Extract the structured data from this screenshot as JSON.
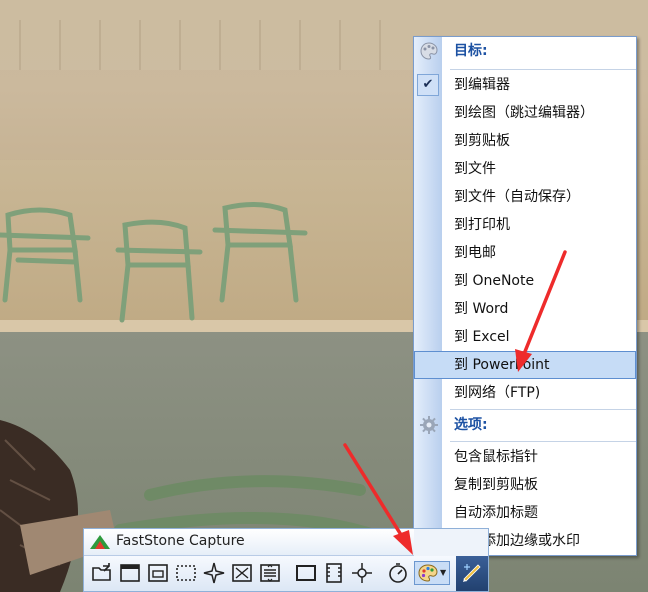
{
  "toolbar": {
    "title": "FastStone Capture",
    "buttons": [
      {
        "name": "open-file-icon"
      },
      {
        "name": "capture-window-icon"
      },
      {
        "name": "capture-object-icon"
      },
      {
        "name": "capture-rectangle-icon"
      },
      {
        "name": "capture-freehand-icon"
      },
      {
        "name": "capture-fullscreen-icon"
      },
      {
        "name": "capture-scrolling-icon"
      },
      {
        "name": "capture-fixed-region-icon"
      },
      {
        "name": "screen-recorder-icon"
      },
      {
        "name": "color-picker-icon"
      },
      {
        "name": "delay-timer-icon"
      },
      {
        "name": "output-destination-icon"
      },
      {
        "name": "settings-brush-icon"
      }
    ]
  },
  "menu": {
    "target_header": "目标:",
    "items": [
      {
        "label": "到编辑器",
        "checked": true
      },
      {
        "label": "到绘图（跳过编辑器）"
      },
      {
        "label": "到剪贴板"
      },
      {
        "label": "到文件"
      },
      {
        "label": "到文件（自动保存）"
      },
      {
        "label": "到打印机"
      },
      {
        "label": "到电邮"
      },
      {
        "label": "到 OneNote"
      },
      {
        "label": "到 Word"
      },
      {
        "label": "到 Excel"
      },
      {
        "label": "到 PowerPoint",
        "highlighted": true
      },
      {
        "label": "到网络（FTP)"
      }
    ],
    "options_header": "选项:",
    "options": [
      {
        "label": "包含鼠标指针"
      },
      {
        "label": "复制到剪贴板"
      },
      {
        "label": "自动添加标题"
      },
      {
        "label": "自动添加边缘或水印"
      }
    ]
  },
  "colors": {
    "menu_header": "#1d52a3",
    "highlight": "#c6dcf6",
    "annotation_arrow": "#ee2b2b"
  }
}
